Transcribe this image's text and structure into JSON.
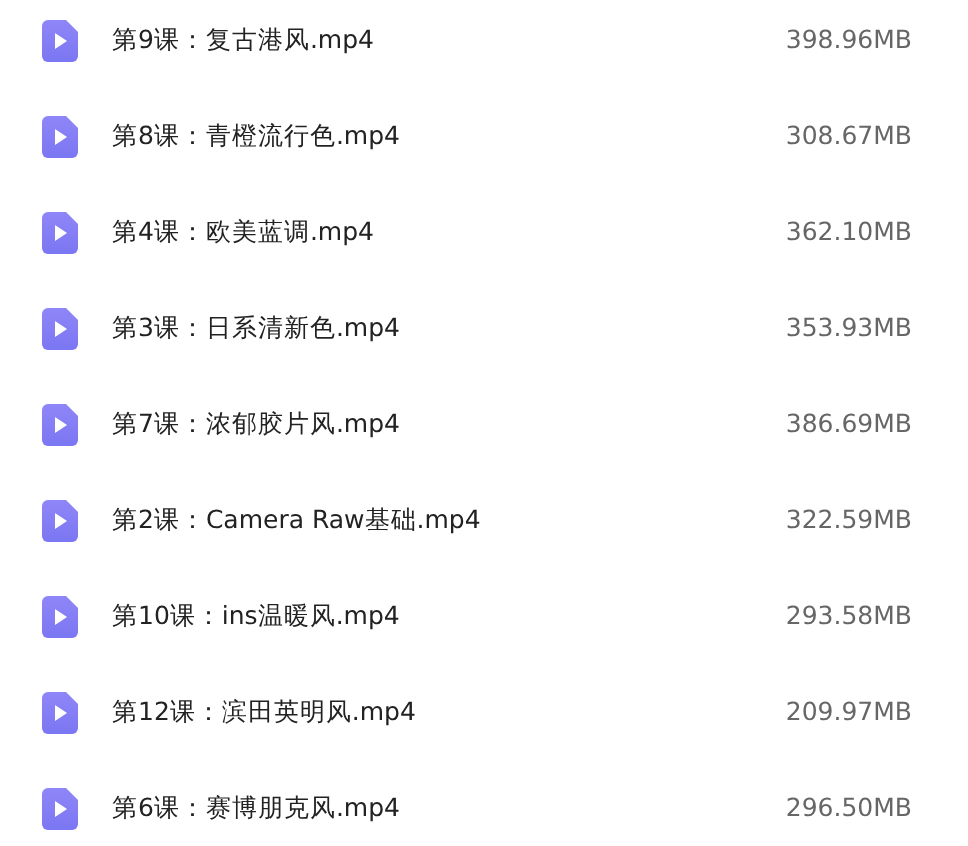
{
  "files": [
    {
      "name": "第9课：复古港风.mp4",
      "size": "398.96MB"
    },
    {
      "name": "第8课：青橙流行色.mp4",
      "size": "308.67MB"
    },
    {
      "name": "第4课：欧美蓝调.mp4",
      "size": "362.10MB"
    },
    {
      "name": "第3课：日系清新色.mp4",
      "size": "353.93MB"
    },
    {
      "name": "第7课：浓郁胶片风.mp4",
      "size": "386.69MB"
    },
    {
      "name": "第2课：Camera Raw基础.mp4",
      "size": "322.59MB"
    },
    {
      "name": "第10课：ins温暖风.mp4",
      "size": "293.58MB"
    },
    {
      "name": "第12课：滨田英明风.mp4",
      "size": "209.97MB"
    },
    {
      "name": "第6课：赛博朋克风.mp4",
      "size": "296.50MB"
    }
  ]
}
